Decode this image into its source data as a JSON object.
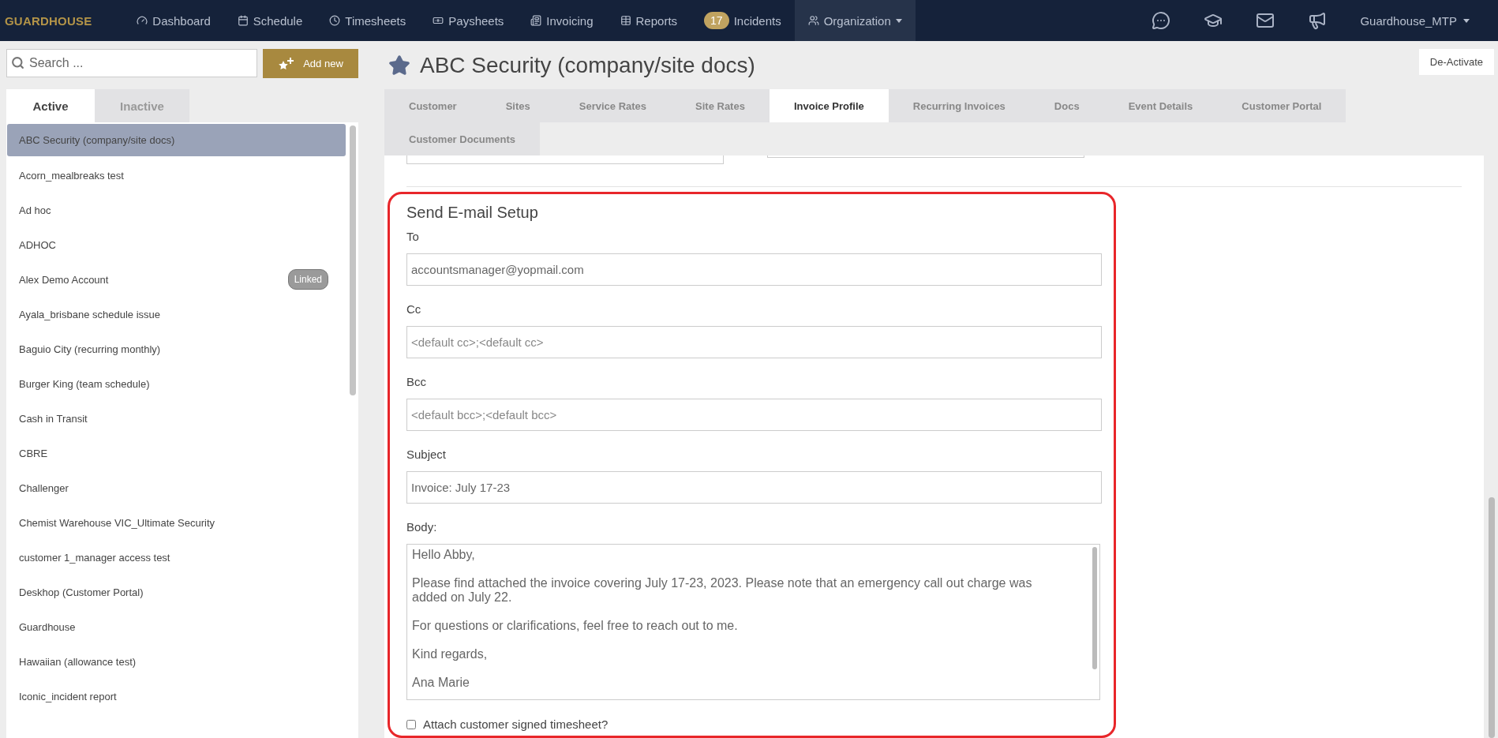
{
  "brand": "GUARDHOUSE",
  "nav": [
    {
      "label": "Dashboard",
      "selected": false
    },
    {
      "label": "Schedule",
      "selected": false
    },
    {
      "label": "Timesheets",
      "selected": false
    },
    {
      "label": "Paysheets",
      "selected": false
    },
    {
      "label": "Invoicing",
      "selected": false
    },
    {
      "label": "Reports",
      "selected": false
    },
    {
      "label": "Incidents",
      "badge": "17",
      "selected": false
    },
    {
      "label": "Organization",
      "dropdown": true,
      "selected": true
    }
  ],
  "user_menu": "Guardhouse_MTP",
  "sidebar": {
    "search": {
      "placeholder": "Search ..."
    },
    "add_button": "Add new",
    "tabs": [
      {
        "label": "Active",
        "selected": true
      },
      {
        "label": "Inactive",
        "selected": false
      }
    ],
    "items": [
      {
        "name": "ABC Security (company/site docs)",
        "selected": true
      },
      {
        "name": "Acorn_mealbreaks test",
        "selected": false
      },
      {
        "name": "Ad hoc",
        "selected": false
      },
      {
        "name": "ADHOC",
        "selected": false
      },
      {
        "name": "Alex Demo Account",
        "selected": false,
        "badge": "Linked"
      },
      {
        "name": "Ayala_brisbane schedule issue",
        "selected": false
      },
      {
        "name": "Baguio City (recurring monthly)",
        "selected": false
      },
      {
        "name": "Burger King (team schedule)",
        "selected": false
      },
      {
        "name": "Cash in Transit",
        "selected": false
      },
      {
        "name": "CBRE",
        "selected": false
      },
      {
        "name": "Challenger",
        "selected": false
      },
      {
        "name": "Chemist Warehouse VIC_Ultimate Security",
        "selected": false
      },
      {
        "name": "customer 1_manager access test",
        "selected": false
      },
      {
        "name": "Deskhop (Customer Portal)",
        "selected": false
      },
      {
        "name": "Guardhouse",
        "selected": false
      },
      {
        "name": "Hawaiian (allowance test)",
        "selected": false
      },
      {
        "name": "Iconic_incident report",
        "selected": false
      }
    ]
  },
  "page_title": "ABC Security (company/site docs)",
  "deactivate_button": "De-Activate",
  "tabs": [
    {
      "label": "Customer",
      "selected": false
    },
    {
      "label": "Sites",
      "selected": false
    },
    {
      "label": "Service Rates",
      "selected": false
    },
    {
      "label": "Site Rates",
      "selected": false
    },
    {
      "label": "Invoice Profile",
      "selected": true
    },
    {
      "label": "Recurring Invoices",
      "selected": false
    },
    {
      "label": "Docs",
      "selected": false
    },
    {
      "label": "Event Details",
      "selected": false
    },
    {
      "label": "Customer Portal",
      "selected": false
    },
    {
      "label": "Customer Documents",
      "selected": false
    }
  ],
  "email_setup": {
    "title": "Send E-mail Setup",
    "fields": [
      {
        "kind": "input",
        "label": "To",
        "value": "accountsmanager@yopmail.com"
      },
      {
        "kind": "input",
        "label": "Cc",
        "placeholder": "<default cc>;<default cc>"
      },
      {
        "kind": "input",
        "label": "Bcc",
        "placeholder": "<default bcc>;<default bcc>"
      },
      {
        "kind": "input",
        "label": "Subject",
        "value": "Invoice: July 17-23"
      },
      {
        "kind": "textarea",
        "label": "Body:",
        "value": "Hello Abby,\n\nPlease find attached the invoice covering July 17-23, 2023. Please note that an emergency call out charge was added on July 22.\n\nFor questions or clarifications, feel free to reach out to me.\n\nKind regards,\n\nAna Marie"
      }
    ],
    "attach_checkbox": {
      "label": "Attach customer signed timesheet?",
      "checked": false
    }
  }
}
